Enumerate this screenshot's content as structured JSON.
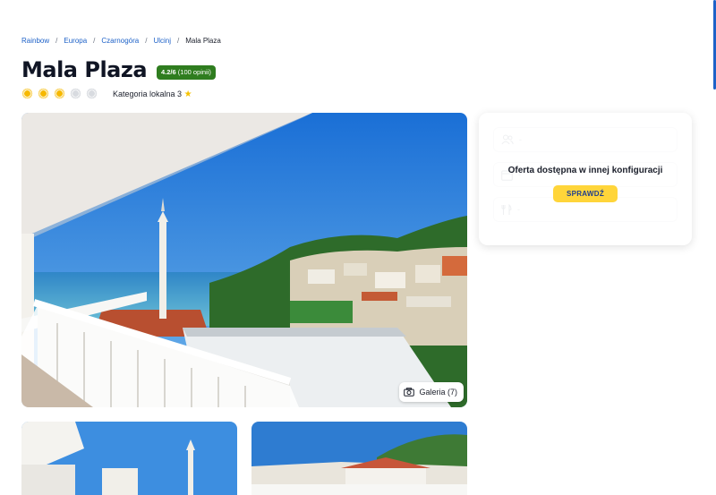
{
  "breadcrumb": {
    "items": [
      "Rainbow",
      "Europa",
      "Czarnogóra",
      "Ulcinj"
    ],
    "current": "Mala Plaza",
    "separator": "/"
  },
  "hotel": {
    "name": "Mala Plaza",
    "rating_score": "4.2/6",
    "rating_reviews": "(100 opinii)",
    "suns_total": 5,
    "suns_filled": 3,
    "category_label": "Kategoria lokalna 3",
    "category_icon": "star-icon"
  },
  "gallery": {
    "button_label": "Galeria (7)",
    "button_icon": "camera-icon"
  },
  "offer": {
    "fields": [
      {
        "icon": "people-icon",
        "value": "-"
      },
      {
        "icon": "calendar-icon",
        "value": "-"
      },
      {
        "icon": "food-icon",
        "value": "-"
      }
    ],
    "unavailable_text": "Oferta dostępna w innej konfiguracji",
    "check_button": "SPRAWDŹ"
  },
  "colors": {
    "link": "#1e62c8",
    "rating_green": "#2f7d1f",
    "accent_yellow": "#ffd53a",
    "sun_on": "#f6b800"
  }
}
